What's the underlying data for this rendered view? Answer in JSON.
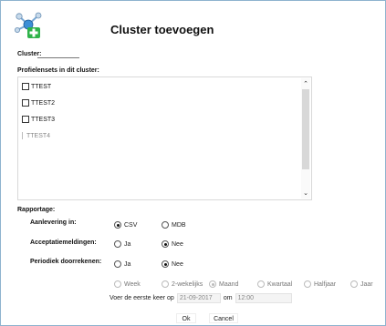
{
  "dialog": {
    "title": "Cluster toevoegen",
    "logo_icon": "cluster-plus-icon"
  },
  "cluster": {
    "label": "Cluster:",
    "value": ""
  },
  "profiles": {
    "label": "Profielensets in dit cluster:",
    "items": [
      {
        "label": "TTEST",
        "checked": false
      },
      {
        "label": "TTEST2",
        "checked": false
      },
      {
        "label": "TTEST3",
        "checked": false
      },
      {
        "label": "TTEST4",
        "checked": false
      }
    ]
  },
  "report": {
    "section_label": "Rapportage:",
    "delivery": {
      "label": "Aanlevering in:",
      "options": [
        "CSV",
        "MDB"
      ],
      "selected": "CSV"
    },
    "acceptance": {
      "label": "Acceptatiemeldingen:",
      "options": [
        "Ja",
        "Nee"
      ],
      "selected": "Nee"
    },
    "periodic": {
      "label": "Periodiek doorrekenen:",
      "options": [
        "Ja",
        "Nee"
      ],
      "selected": "Nee"
    },
    "frequency": {
      "options": [
        "Week",
        "2-wekelijks",
        "Maand",
        "Kwartaal",
        "Halfjaar",
        "Jaar"
      ],
      "selected": "Maand"
    },
    "first_run": {
      "prefix": "Voer de eerste keer op",
      "date": "21-09-2017",
      "mid": "om",
      "time": "12:00"
    }
  },
  "buttons": {
    "ok": "Ok",
    "cancel": "Cancel"
  },
  "colors": {
    "frame_border": "#8fb3cf",
    "logo_green": "#2fb34a",
    "logo_blue": "#3d8fd6"
  }
}
